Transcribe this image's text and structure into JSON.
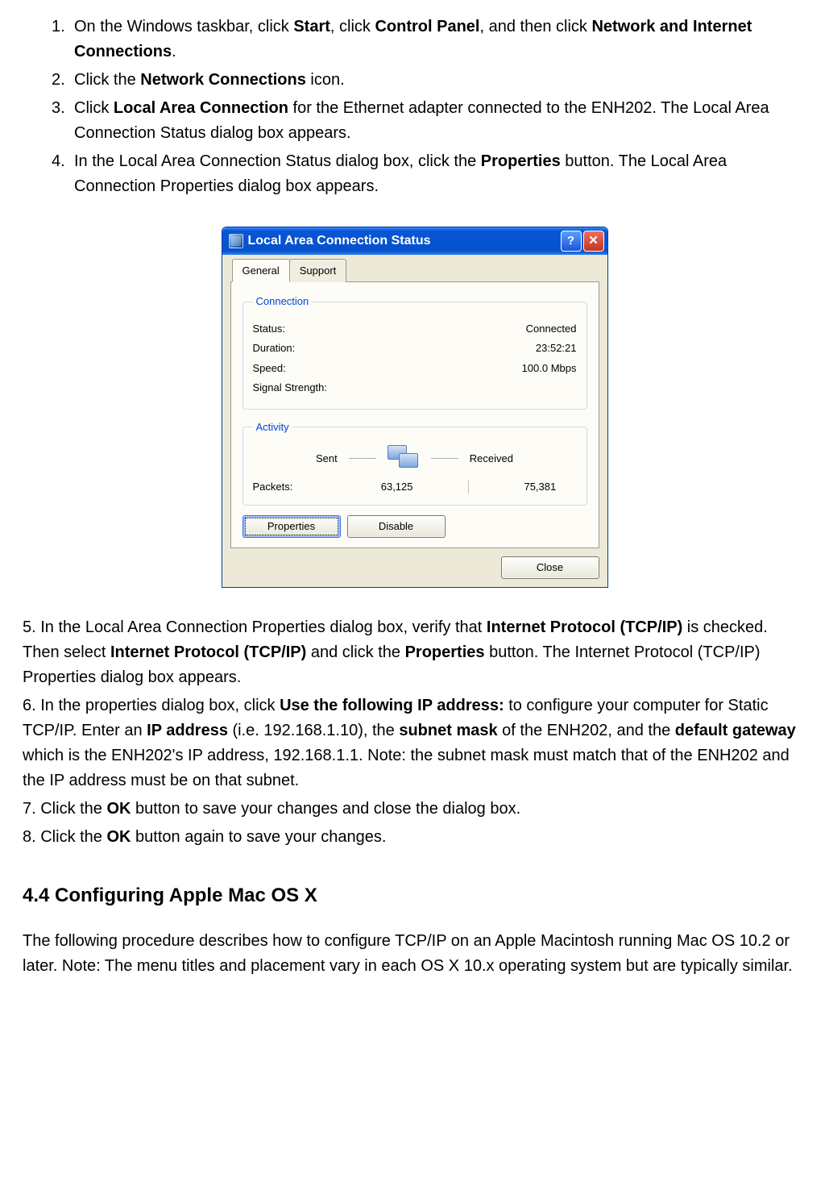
{
  "steps": {
    "s1_pre": "On the Windows taskbar, click ",
    "s1_b1": "Start",
    "s1_mid1": ", click ",
    "s1_b2": "Control Panel",
    "s1_mid2": ", and then click ",
    "s1_b3": "Network and Internet Connections",
    "s1_post": ".",
    "s2_pre": "Click the ",
    "s2_b1": "Network Connections",
    "s2_post": " icon.",
    "s3_pre": "Click ",
    "s3_b1": "Local Area Connection",
    "s3_post": " for the Ethernet adapter connected to the ENH202. The Local Area Connection Status dialog box appears.",
    "s4_pre": "In the Local Area Connection Status dialog box, click the ",
    "s4_b1": "Properties",
    "s4_post": " button. The Local Area Connection Properties dialog box appears.",
    "s5_pre": "5.    In the Local Area Connection Properties dialog box, verify that ",
    "s5_b1": "Internet Protocol (TCP/IP)",
    "s5_mid1": " is checked. Then select ",
    "s5_b2": "Internet Protocol (TCP/IP)",
    "s5_mid2": " and click the ",
    "s5_b3": "Properties",
    "s5_post": " button. The Internet Protocol (TCP/IP) Properties dialog box appears.",
    "s6_pre": "6.    In the properties dialog box, click ",
    "s6_b1": "Use the following IP address:",
    "s6_mid1": " to configure your computer for Static TCP/IP.   Enter an ",
    "s6_b2": "IP address",
    "s6_mid2": " (i.e. 192.168.1.10), the ",
    "s6_b3": "subnet mask",
    "s6_mid3": " of the ENH202, and the ",
    "s6_b4": "default gateway",
    "s6_post": " which is the ENH202's IP address, 192.168.1.1.   Note: the subnet mask must match that of the ENH202 and the IP address must be on that subnet.",
    "s7_pre": "7.    Click the ",
    "s7_b1": "OK",
    "s7_post": " button to save your changes and close the dialog box.",
    "s8_pre": "8.    Click the ",
    "s8_b1": "OK",
    "s8_post": " button again to save your changes."
  },
  "nums": {
    "n1": "1.",
    "n2": "2.",
    "n3": "3.",
    "n4": "4."
  },
  "section_heading": "4.4 Configuring Apple Mac OS X",
  "section_para": "The following procedure describes how to configure TCP/IP on an Apple Macintosh running Mac OS 10.2 or later.   Note: The menu titles and placement vary in each OS X 10.x operating system but are typically similar.",
  "dialog": {
    "title": "Local Area Connection Status",
    "help_btn": "?",
    "close_btn": "✕",
    "tabs": {
      "general": "General",
      "support": "Support"
    },
    "connection": {
      "legend": "Connection",
      "status_label": "Status:",
      "status_value": "Connected",
      "duration_label": "Duration:",
      "duration_value": "23:52:21",
      "speed_label": "Speed:",
      "speed_value": "100.0 Mbps",
      "signal_label": "Signal Strength:"
    },
    "activity": {
      "legend": "Activity",
      "sent_label": "Sent",
      "received_label": "Received",
      "packets_label": "Packets:",
      "packets_sent": "63,125",
      "packets_received": "75,381"
    },
    "buttons": {
      "properties": "Properties",
      "disable": "Disable",
      "close": "Close"
    }
  }
}
